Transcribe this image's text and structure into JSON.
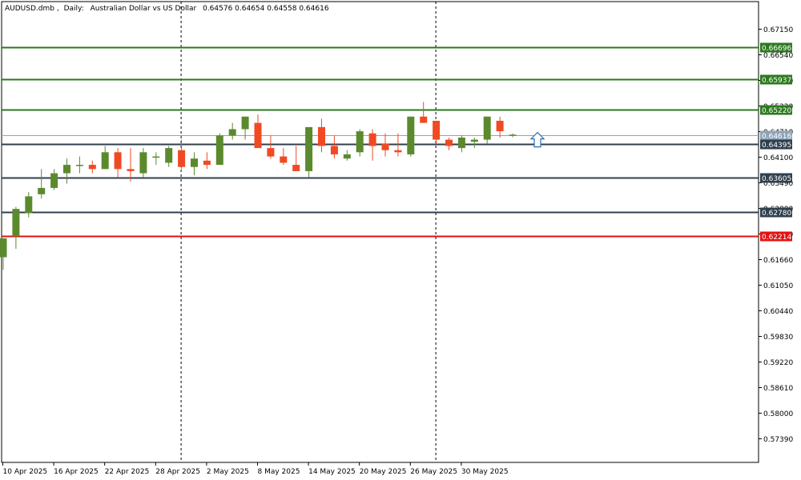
{
  "header": {
    "symbol": "AUDUSD.dmb",
    "timeframe": "Daily:",
    "description": "Australian Dollar vs US Dollar",
    "ohlc": "0.64576 0.64654 0.64558 0.64616"
  },
  "colors": {
    "bull": "#5b8a2e",
    "bear": "#f04a23",
    "resistance": "#2b7a1e",
    "support": "#2f3f4c",
    "stop": "#e21212",
    "current": "#8fa3b6",
    "grid": "#000000",
    "arrow": "#2a6fb0"
  },
  "chart_data": {
    "type": "candlestick",
    "ylim": [
      0.5681,
      0.6779
    ],
    "y_ticks": [
      "0.67150",
      "0.66540",
      "0.65930",
      "0.65320",
      "0.64710",
      "0.64100",
      "0.63490",
      "0.62880",
      "0.62270",
      "0.61660",
      "0.61050",
      "0.60440",
      "0.59830",
      "0.59220",
      "0.58610",
      "0.58000",
      "0.57390"
    ],
    "x_labels": [
      "10 Apr 2025",
      "16 Apr 2025",
      "22 Apr 2025",
      "28 Apr 2025",
      "2 May 2025",
      "8 May 2025",
      "14 May 2025",
      "20 May 2025",
      "26 May 2025",
      "30 May 2025"
    ],
    "candles": [
      {
        "o": 0.617,
        "h": 0.6215,
        "l": 0.614,
        "c": 0.6215
      },
      {
        "o": 0.622,
        "h": 0.629,
        "l": 0.619,
        "c": 0.6285
      },
      {
        "o": 0.6275,
        "h": 0.6325,
        "l": 0.6265,
        "c": 0.6315
      },
      {
        "o": 0.632,
        "h": 0.638,
        "l": 0.631,
        "c": 0.6335
      },
      {
        "o": 0.6335,
        "h": 0.638,
        "l": 0.633,
        "c": 0.637
      },
      {
        "o": 0.637,
        "h": 0.6405,
        "l": 0.6345,
        "c": 0.639
      },
      {
        "o": 0.639,
        "h": 0.641,
        "l": 0.637,
        "c": 0.639
      },
      {
        "o": 0.639,
        "h": 0.64,
        "l": 0.637,
        "c": 0.638
      },
      {
        "o": 0.638,
        "h": 0.6435,
        "l": 0.638,
        "c": 0.642
      },
      {
        "o": 0.642,
        "h": 0.643,
        "l": 0.636,
        "c": 0.638
      },
      {
        "o": 0.638,
        "h": 0.643,
        "l": 0.635,
        "c": 0.6375
      },
      {
        "o": 0.637,
        "h": 0.643,
        "l": 0.636,
        "c": 0.642
      },
      {
        "o": 0.641,
        "h": 0.642,
        "l": 0.639,
        "c": 0.641
      },
      {
        "o": 0.6395,
        "h": 0.6435,
        "l": 0.6385,
        "c": 0.643
      },
      {
        "o": 0.6425,
        "h": 0.645,
        "l": 0.638,
        "c": 0.6385
      },
      {
        "o": 0.6385,
        "h": 0.642,
        "l": 0.6365,
        "c": 0.6405
      },
      {
        "o": 0.64,
        "h": 0.642,
        "l": 0.638,
        "c": 0.639
      },
      {
        "o": 0.639,
        "h": 0.6465,
        "l": 0.639,
        "c": 0.646
      },
      {
        "o": 0.646,
        "h": 0.649,
        "l": 0.645,
        "c": 0.6475
      },
      {
        "o": 0.6475,
        "h": 0.6505,
        "l": 0.645,
        "c": 0.6505
      },
      {
        "o": 0.649,
        "h": 0.651,
        "l": 0.6435,
        "c": 0.643
      },
      {
        "o": 0.643,
        "h": 0.646,
        "l": 0.6405,
        "c": 0.641
      },
      {
        "o": 0.641,
        "h": 0.643,
        "l": 0.639,
        "c": 0.6395
      },
      {
        "o": 0.639,
        "h": 0.6435,
        "l": 0.6375,
        "c": 0.6375
      },
      {
        "o": 0.6375,
        "h": 0.6475,
        "l": 0.636,
        "c": 0.648
      },
      {
        "o": 0.648,
        "h": 0.65,
        "l": 0.642,
        "c": 0.6435
      },
      {
        "o": 0.6435,
        "h": 0.646,
        "l": 0.6405,
        "c": 0.6415
      },
      {
        "o": 0.6405,
        "h": 0.6425,
        "l": 0.64,
        "c": 0.6415
      },
      {
        "o": 0.642,
        "h": 0.6475,
        "l": 0.641,
        "c": 0.647
      },
      {
        "o": 0.6465,
        "h": 0.6475,
        "l": 0.64,
        "c": 0.6435
      },
      {
        "o": 0.644,
        "h": 0.6465,
        "l": 0.641,
        "c": 0.6425
      },
      {
        "o": 0.6425,
        "h": 0.6465,
        "l": 0.641,
        "c": 0.642
      },
      {
        "o": 0.6415,
        "h": 0.6505,
        "l": 0.641,
        "c": 0.6505
      },
      {
        "o": 0.6505,
        "h": 0.654,
        "l": 0.649,
        "c": 0.649
      },
      {
        "o": 0.6495,
        "h": 0.6495,
        "l": 0.644,
        "c": 0.645
      },
      {
        "o": 0.645,
        "h": 0.6455,
        "l": 0.6425,
        "c": 0.6435
      },
      {
        "o": 0.643,
        "h": 0.646,
        "l": 0.642,
        "c": 0.6455
      },
      {
        "o": 0.6445,
        "h": 0.6455,
        "l": 0.643,
        "c": 0.645
      },
      {
        "o": 0.645,
        "h": 0.6505,
        "l": 0.644,
        "c": 0.6505
      },
      {
        "o": 0.6495,
        "h": 0.6505,
        "l": 0.6455,
        "c": 0.647
      },
      {
        "o": 0.6462,
        "h": 0.6465,
        "l": 0.6456,
        "c": 0.6462
      }
    ],
    "levels": [
      {
        "price": 0.66696,
        "label": "0.66696",
        "kind": "resistance"
      },
      {
        "price": 0.65937,
        "label": "0.65937",
        "kind": "resistance"
      },
      {
        "price": 0.6522,
        "label": "0.65220",
        "kind": "resistance"
      },
      {
        "price": 0.64616,
        "label": "0.64616",
        "kind": "current"
      },
      {
        "price": 0.64395,
        "label": "0.64395",
        "kind": "support"
      },
      {
        "price": 0.63605,
        "label": "0.63605",
        "kind": "support"
      },
      {
        "price": 0.6278,
        "label": "0.62780",
        "kind": "support"
      },
      {
        "price": 0.62214,
        "label": "0.62214",
        "kind": "stop"
      }
    ],
    "separators_at_candle": [
      14,
      34
    ],
    "arrow": {
      "direction": "up",
      "price": 0.645
    }
  }
}
